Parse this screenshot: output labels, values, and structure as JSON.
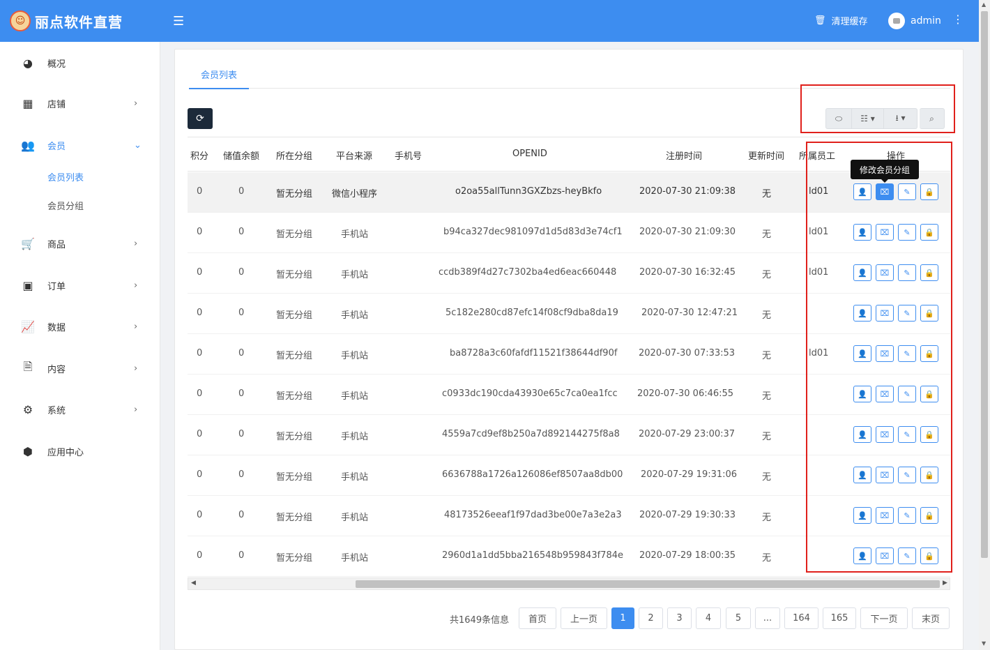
{
  "header": {
    "brand": "丽点软件直营",
    "menu_icon": "hamburger-icon",
    "clear_cache": "清理缓存",
    "username": "admin",
    "bg_color": "#3d8df0"
  },
  "sidebar": {
    "items": [
      {
        "label": "概况",
        "icon": "dashboard-icon",
        "glyph": "◕",
        "chevron": ""
      },
      {
        "label": "店铺",
        "icon": "grid-icon",
        "glyph": "▦",
        "chevron": "›"
      },
      {
        "label": "会员",
        "icon": "users-icon",
        "glyph": "👥",
        "chevron": "⌄"
      },
      {
        "label": "商品",
        "icon": "cart-icon",
        "glyph": "🛒",
        "chevron": "›"
      },
      {
        "label": "订单",
        "icon": "money-icon",
        "glyph": "▣",
        "chevron": "›"
      },
      {
        "label": "数据",
        "icon": "chart-icon",
        "glyph": "📈",
        "chevron": "›"
      },
      {
        "label": "内容",
        "icon": "document-icon",
        "glyph": "🗎",
        "chevron": "›"
      },
      {
        "label": "系统",
        "icon": "gear-icon",
        "glyph": "⚙",
        "chevron": "›"
      },
      {
        "label": "应用中心",
        "icon": "cube-icon",
        "glyph": "⬢",
        "chevron": ""
      }
    ],
    "subitems": [
      "会员列表",
      "会员分组"
    ]
  },
  "tab": "会员列表",
  "columns": [
    "积分",
    "储值余额",
    "所在分组",
    "平台来源",
    "手机号",
    "OPENID",
    "注册时间",
    "更新时间",
    "所属员工",
    "操作"
  ],
  "tooltip": "修改会员分组",
  "rows": [
    {
      "points": "0",
      "balance": "0",
      "group": "暂无分组",
      "source": "微信小程序",
      "phone": "",
      "openid": "o2oa55allTunn3GXZbzs-heyBkfo",
      "reg_time": "2020-07-30 21:09:38",
      "update_time": "无",
      "staff": "ld01"
    },
    {
      "points": "0",
      "balance": "0",
      "group": "暂无分组",
      "source": "手机站",
      "phone": "",
      "openid": "b94ca327dec981097d1d5d83d3e74cf1",
      "reg_time": "2020-07-30 21:09:30",
      "update_time": "无",
      "staff": "ld01"
    },
    {
      "points": "0",
      "balance": "0",
      "group": "暂无分组",
      "source": "手机站",
      "phone": "",
      "openid": "ccdb389f4d27c7302ba4ed6eac660448",
      "reg_time": "2020-07-30 16:32:45",
      "update_time": "无",
      "staff": "ld01"
    },
    {
      "points": "0",
      "balance": "0",
      "group": "暂无分组",
      "source": "手机站",
      "phone": "",
      "openid": "5c182e280cd87efc14f08cf9dba8da19",
      "reg_time": "2020-07-30 12:47:21",
      "update_time": "无",
      "staff": ""
    },
    {
      "points": "0",
      "balance": "0",
      "group": "暂无分组",
      "source": "手机站",
      "phone": "",
      "openid": "ba8728a3c60fafdf11521f38644df90f",
      "reg_time": "2020-07-30 07:33:53",
      "update_time": "无",
      "staff": "ld01"
    },
    {
      "points": "0",
      "balance": "0",
      "group": "暂无分组",
      "source": "手机站",
      "phone": "",
      "openid": "c0933dc190cda43930e65c7ca0ea1fcc",
      "reg_time": "2020-07-30 06:46:55",
      "update_time": "无",
      "staff": ""
    },
    {
      "points": "0",
      "balance": "0",
      "group": "暂无分组",
      "source": "手机站",
      "phone": "",
      "openid": "4559a7cd9ef8b250a7d892144275f8a8",
      "reg_time": "2020-07-29 23:00:37",
      "update_time": "无",
      "staff": ""
    },
    {
      "points": "0",
      "balance": "0",
      "group": "暂无分组",
      "source": "手机站",
      "phone": "",
      "openid": "6636788a1726a126086ef8507aa8db00",
      "reg_time": "2020-07-29 19:31:06",
      "update_time": "无",
      "staff": ""
    },
    {
      "points": "0",
      "balance": "0",
      "group": "暂无分组",
      "source": "手机站",
      "phone": "",
      "openid": "48173526eeaf1f97dad3be00e7a3e2a3",
      "reg_time": "2020-07-29 19:30:33",
      "update_time": "无",
      "staff": ""
    },
    {
      "points": "0",
      "balance": "0",
      "group": "暂无分组",
      "source": "手机站",
      "phone": "",
      "openid": "2960d1a1dd5bba216548b959843f784e",
      "reg_time": "2020-07-29 18:00:35",
      "update_time": "无",
      "staff": ""
    }
  ],
  "ops": [
    {
      "icon": "user-icon",
      "glyph": "👤"
    },
    {
      "icon": "group-edit-icon",
      "glyph": "⌧"
    },
    {
      "icon": "pencil-icon",
      "glyph": "✎"
    },
    {
      "icon": "lock-icon",
      "glyph": "🔒"
    }
  ],
  "pagination": {
    "info": "共1649条信息",
    "first": "首页",
    "prev": "上一页",
    "pages": [
      "1",
      "2",
      "3",
      "4",
      "5",
      "...",
      "164",
      "165"
    ],
    "current": "1",
    "next": "下一页",
    "last": "末页"
  }
}
